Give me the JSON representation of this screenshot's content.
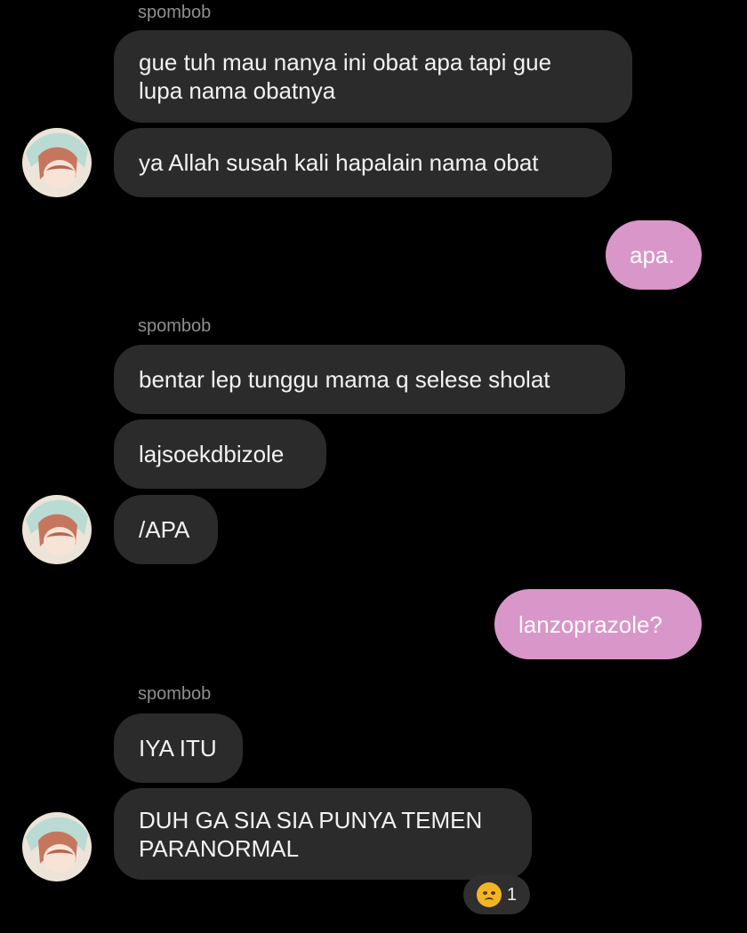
{
  "chat": {
    "blocks": [
      {
        "sender": "spombob",
        "messages": [
          "gue tuh mau nanya ini obat apa tapi gue\nlupa nama obatnya",
          "ya Allah susah kali hapalain nama obat"
        ]
      },
      {
        "self": "apa."
      },
      {
        "sender": "spombob",
        "messages": [
          "bentar lep tunggu mama q selese sholat",
          "lajsoekdbizole",
          "/APA"
        ]
      },
      {
        "self": "lanzoprazole?"
      },
      {
        "sender": "spombob",
        "messages": [
          "IYA ITU",
          "DUH GA SIA SIA PUNYA TEMEN\nPARANORMAL"
        ]
      }
    ],
    "reaction": {
      "icon": "angry-face-icon",
      "count": "1"
    }
  }
}
